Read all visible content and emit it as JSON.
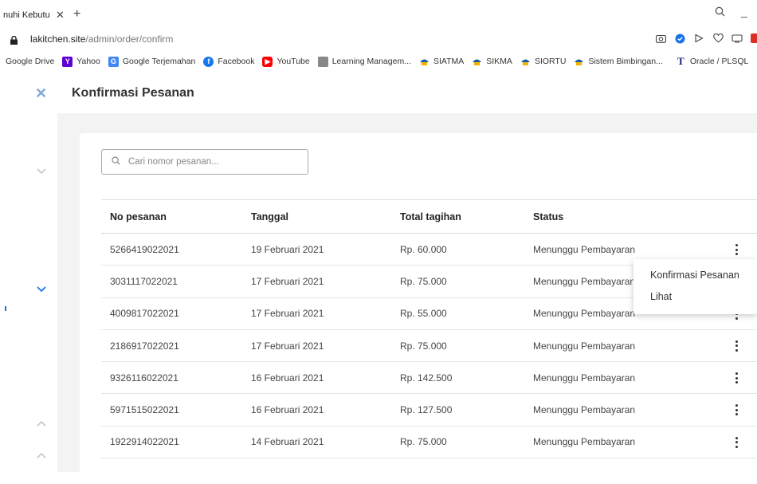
{
  "browser": {
    "tab_title": "nuhi Kebutu",
    "tab_close": "✕",
    "new_tab": "+",
    "url_host": "lakitchen.site",
    "url_path": "/admin/order/confirm",
    "bookmarks": [
      {
        "label": "Google Drive",
        "icon": "none",
        "color": ""
      },
      {
        "label": "Yahoo",
        "icon": "yahoo-icon",
        "color": "#5f01d1"
      },
      {
        "label": "Google Terjemahan",
        "icon": "translate-icon",
        "color": "#4285f4"
      },
      {
        "label": "Facebook",
        "icon": "facebook-icon",
        "color": "#1877f2"
      },
      {
        "label": "YouTube",
        "icon": "youtube-icon",
        "color": "#ff0000"
      },
      {
        "label": "Learning Managem...",
        "icon": "lms-icon",
        "color": "#666666"
      },
      {
        "label": "SIATMA",
        "icon": "siatma-icon",
        "color": "#1b5fa8"
      },
      {
        "label": "SIKMA",
        "icon": "sikma-icon",
        "color": "#1b5fa8"
      },
      {
        "label": "SIORTU",
        "icon": "siortu-icon",
        "color": "#1b5fa8"
      },
      {
        "label": "Sistem Bimbingan...",
        "icon": "bimbingan-icon",
        "color": "#1b5fa8"
      },
      {
        "label": "Oracle / PLSQL",
        "icon": "oracle-icon",
        "color": "#1a237e"
      }
    ]
  },
  "header": {
    "close_icon": "close-icon",
    "title": "Konfirmasi Pesanan"
  },
  "search": {
    "placeholder": "Cari nomor pesanan...",
    "value": ""
  },
  "table": {
    "headers": [
      "No pesanan",
      "Tanggal",
      "Total tagihan",
      "Status"
    ],
    "rows": [
      {
        "no": "5266419022021",
        "date": "19 Februari 2021",
        "total": "Rp. 60.000",
        "status": "Menunggu Pembayaran"
      },
      {
        "no": "3031117022021",
        "date": "17 Februari 2021",
        "total": "Rp. 75.000",
        "status": "Menunggu Pembayaran"
      },
      {
        "no": "4009817022021",
        "date": "17 Februari 2021",
        "total": "Rp. 55.000",
        "status": "Menunggu Pembayaran"
      },
      {
        "no": "2186917022021",
        "date": "17 Februari 2021",
        "total": "Rp. 75.000",
        "status": "Menunggu Pembayaran"
      },
      {
        "no": "9326116022021",
        "date": "16 Februari 2021",
        "total": "Rp. 142.500",
        "status": "Menunggu Pembayaran"
      },
      {
        "no": "5971515022021",
        "date": "16 Februari 2021",
        "total": "Rp. 127.500",
        "status": "Menunggu Pembayaran"
      },
      {
        "no": "1922914022021",
        "date": "14 Februari 2021",
        "total": "Rp. 75.000",
        "status": "Menunggu Pembayaran"
      }
    ]
  },
  "menu": {
    "items": [
      "Konfirmasi Pesanan",
      "Lihat"
    ]
  },
  "colors": {
    "accent": "#1a73e8",
    "close_icon": "#7fa9d9",
    "content_bg": "#f3f3f3"
  }
}
